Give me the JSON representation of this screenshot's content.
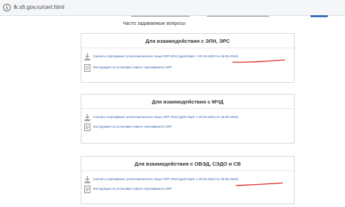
{
  "browser": {
    "url": "lk.sfr.gov.ru/cert.html",
    "page_icon": "page-info-icon"
  },
  "faq_label": "Часто задаваемые вопросы",
  "sections": [
    {
      "title": "Для взаимодействия с ЭЛН, ЭРС",
      "download_link": "Скачать Сертификат уполномоченного лица СФР 2023 (действует с 20.02.2023 по 16.05.2024)",
      "instruction_link": "Инструкция по установке нового сертификата СФР"
    },
    {
      "title": "Для взаимодействия с МЧД",
      "download_link": "Скачать Сертификат уполномоченного лица СФР 2023 (действует с 20.02.2023 по 16.05.2024)",
      "instruction_link": "Инструкция по установке нового сертификата СФР"
    },
    {
      "title": "Для взаимодействия с ОВЭД, СЭДО и СВ",
      "download_link": "Скачать Сертификат уполномоченного лица СФР 2023 (действует с 20.02.2023 по 16.05.2024)",
      "instruction_link": "Инструкция по установке нового сертификата СФР"
    }
  ],
  "annotation_color": "#e0201a",
  "link_color": "#2a5aa8"
}
